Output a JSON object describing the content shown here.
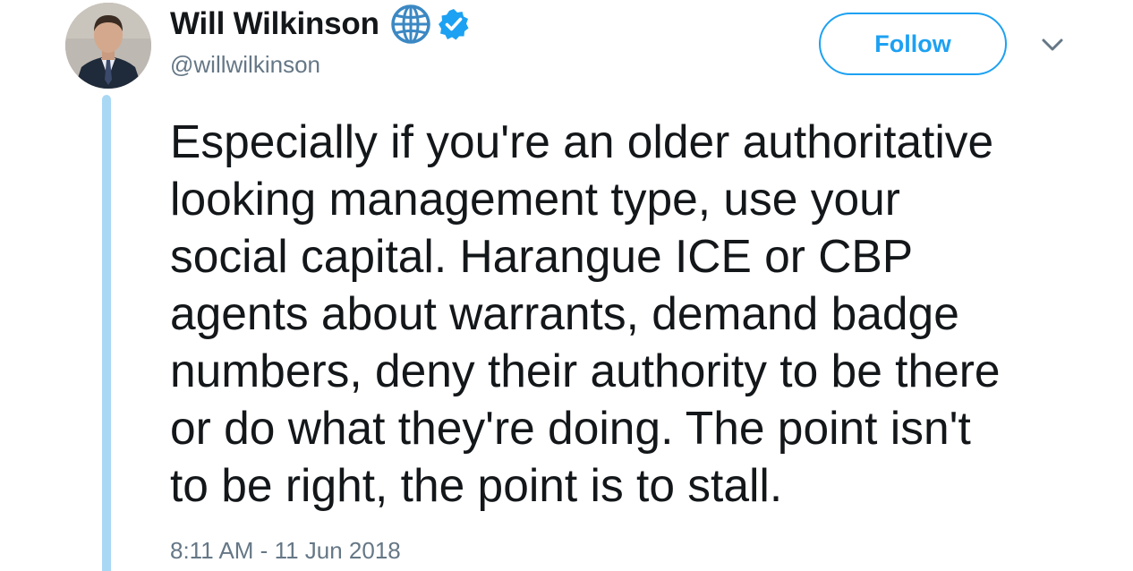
{
  "author": {
    "display_name": "Will Wilkinson",
    "handle": "@willwilkinson",
    "avatar_icon": "person-avatar",
    "globe_icon": "globe-icon",
    "verified_icon": "verified-badge-icon"
  },
  "actions": {
    "follow_label": "Follow",
    "more_icon": "chevron-down-icon"
  },
  "tweet": {
    "text": "Especially if you're an older authoritative\nlooking management type, use your\nsocial capital. Harangue ICE or CBP\nagents about warrants, demand badge\nnumbers, deny their authority to be there\nor do what they're doing. The point isn't\nto be right, the point is to stall.",
    "timestamp": "8:11 AM - 11 Jun 2018"
  },
  "colors": {
    "accent": "#1da1f2",
    "thread_line": "#a9d8f5",
    "secondary_text": "#657786",
    "primary_text": "#14171a"
  }
}
